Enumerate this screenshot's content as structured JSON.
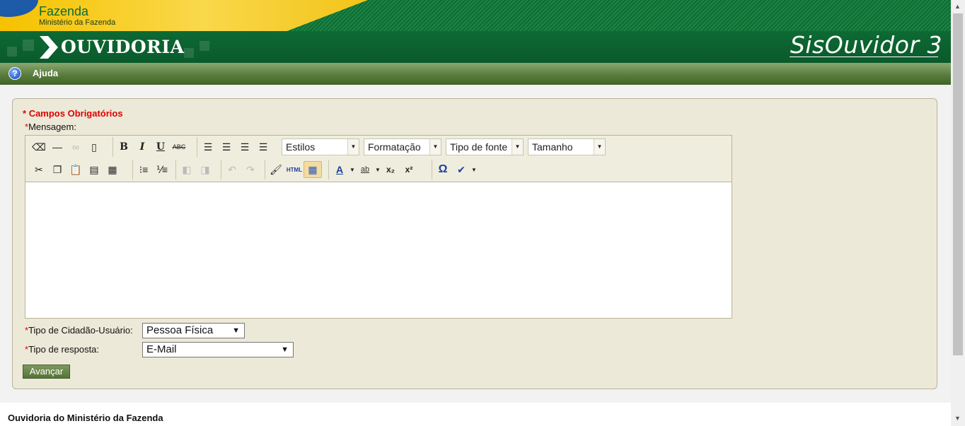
{
  "header": {
    "brand_name": "Fazenda",
    "brand_sub": "Ministério da Fazenda",
    "logo_text": "OUVIDORIA",
    "product_name": "SisOuvidor 3"
  },
  "menu": {
    "help_label": "Ajuda"
  },
  "form": {
    "required_note": "Campos Obrigatórios",
    "required_marker": "*",
    "message_label": "Mensagem:",
    "citizen_type_label": "Tipo de Cidadão-Usuário:",
    "citizen_type_value": "Pessoa Física",
    "response_type_label": "Tipo de resposta:",
    "response_type_value": "E-Mail",
    "advance_label": "Avançar"
  },
  "editor": {
    "styles_select": "Estilos",
    "format_select": "Formatação",
    "font_select": "Tipo de fonte",
    "size_select": "Tamanho",
    "buttons": {
      "bold": "B",
      "italic": "I",
      "underline": "U",
      "strike": "ABC",
      "html": "HTML",
      "subscript": "x₂",
      "superscript": "x²",
      "special_char": "Ω",
      "font_color": "A",
      "highlight": "ab"
    }
  },
  "footer": {
    "text": "Ouvidoria do Ministério da Fazenda"
  },
  "colors": {
    "brand_green": "#0d6a33",
    "menu_green": "#5a7d3e",
    "required_red": "#e00000",
    "panel_bg": "#ece9d8"
  }
}
